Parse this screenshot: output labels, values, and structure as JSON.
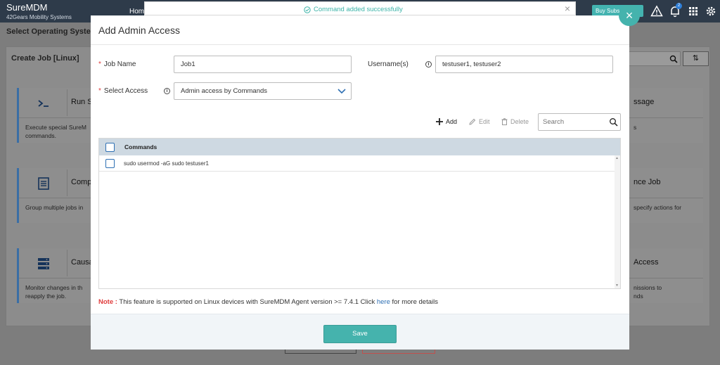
{
  "app": {
    "name": "SureMDM",
    "company": "42Gears Mobility Systems",
    "nav_home": "Hom",
    "buy_label": "Buy Subs",
    "notification_count": "2"
  },
  "background": {
    "os_title": "Select Operating Syste",
    "panel_title": "Create Job [Linux]",
    "sort_label": "⇅",
    "cards": [
      {
        "title": "Run S",
        "desc": [
          "Execute special SureM",
          "commands."
        ],
        "icon": "terminal-icon"
      },
      {
        "title": "Comp",
        "desc": [
          "Group multiple jobs in"
        ],
        "icon": "list-icon"
      },
      {
        "title": "Causa",
        "desc": [
          "Monitor changes in th",
          "reapply the job."
        ],
        "icon": "server-icon"
      }
    ],
    "right_cards": [
      {
        "title": "ssage",
        "desc": [
          "s"
        ]
      },
      {
        "title": "nce Job",
        "desc": [
          "specify actions for"
        ]
      },
      {
        "title": "Access",
        "desc": [
          "nissions to",
          "nds"
        ]
      }
    ]
  },
  "toast": {
    "message": "Command added successfully"
  },
  "modal": {
    "title": "Add Admin Access",
    "job_name_label": "Job Name",
    "job_name_value": "Job1",
    "usernames_label": "Username(s)",
    "usernames_value": "testuser1, testuser2",
    "select_access_label": "Select Access",
    "select_access_value": "Admin access by Commands",
    "toolbar": {
      "add": "Add",
      "edit": "Edit",
      "delete": "Delete",
      "search_placeholder": "Search"
    },
    "grid": {
      "header": "Commands",
      "rows": [
        "sudo usermod -aG sudo testuser1"
      ]
    },
    "note": {
      "label": "Note :",
      "text": " This feature is supported on Linux devices with SureMDM Agent version >= 7.4.1 Click ",
      "link": "here",
      "tail": " for more details"
    },
    "save_label": "Save"
  },
  "colors": {
    "accent": "#45b3ad",
    "topbar": "#2e3b4a",
    "link": "#2d6fb3",
    "required": "#e03b3b"
  }
}
